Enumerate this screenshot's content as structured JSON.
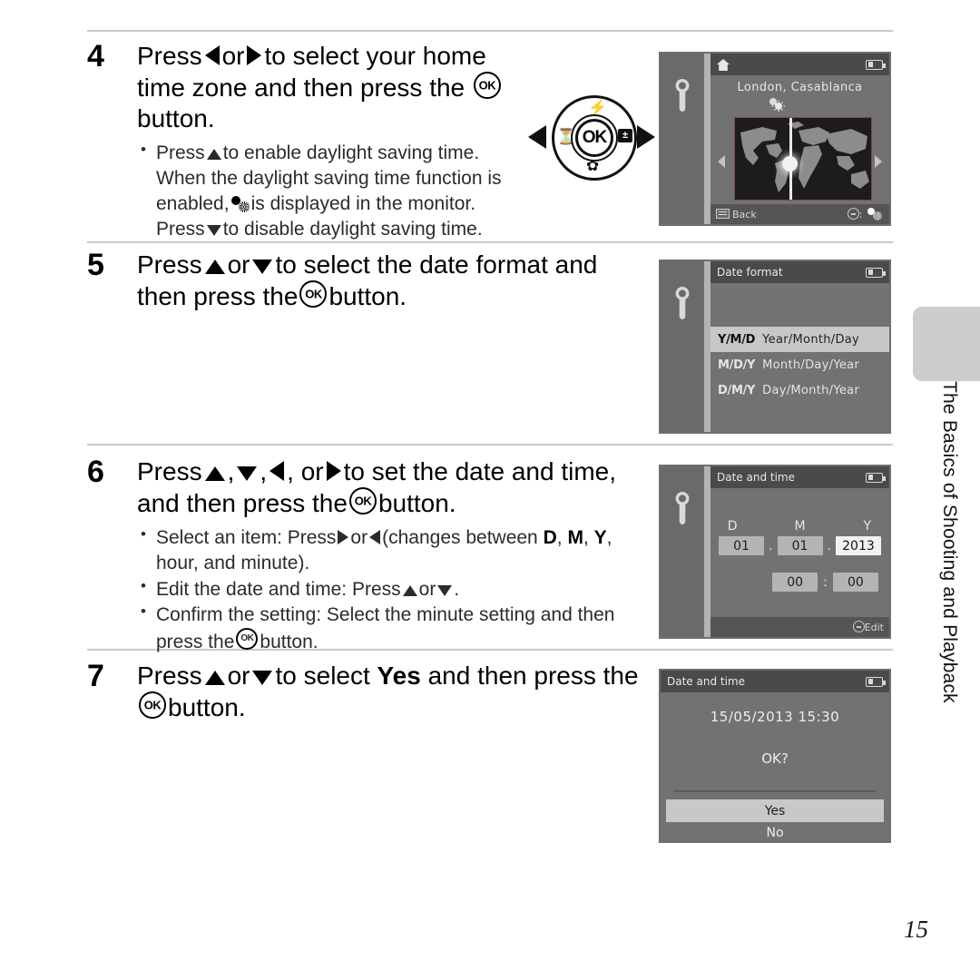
{
  "page": {
    "number": "15",
    "chapter_tab_label": "The Basics of Shooting and Playback"
  },
  "steps": [
    {
      "number": "4",
      "title_parts": [
        "Press ",
        "◀",
        " or ",
        "▶",
        " to select your home time zone and then press the ",
        "OK",
        " button."
      ],
      "title_plain": "Press  or  to select your home time zone and then press the  button.",
      "t1": "Press",
      "t2": "or",
      "t3": "to select your home",
      "t4": "time zone and then press the",
      "t5": "button.",
      "bullets": [
        {
          "a": "Press",
          "b": "to enable daylight saving time.",
          "c": "When the daylight saving time function is",
          "d": "enabled,",
          "e": "is displayed in the monitor.",
          "f": "Press",
          "g": "to disable daylight saving time."
        }
      ]
    },
    {
      "number": "5",
      "t1": "Press",
      "t2": "or",
      "t3": "to select the date format and",
      "t4": "then press the",
      "t5": "button."
    },
    {
      "number": "6",
      "t1": "Press",
      "t2": ",",
      "t3": ",",
      "t4": ", or",
      "t5": "to set the date and time,",
      "t6": "and then press the",
      "t7": "button.",
      "bullets": [
        {
          "a": "Select an item: Press",
          "b": "or",
          "c": "(changes between",
          "d": "D",
          "e": ",",
          "f": "M",
          "g": ",",
          "h": "Y",
          "i": ",",
          "j": "hour, and minute)."
        },
        {
          "a": "Edit the date and time: Press",
          "b": "or",
          "c": "."
        },
        {
          "a": "Confirm the setting: Select the minute setting and then",
          "b": "press the",
          "c": "button."
        }
      ]
    },
    {
      "number": "7",
      "t1": "Press",
      "t2": "or",
      "t3": "to select",
      "t4": "Yes",
      "t5": "and then press the",
      "t6": "button."
    }
  ],
  "multi_selector": {
    "center_label": "OK",
    "top_icon": "flash-icon",
    "left_icon": "self-timer-icon",
    "right_icon": "exposure-compensation-icon",
    "right_icon_label": "±",
    "bottom_icon": "macro-flower-icon",
    "top_glyph": "⚡",
    "left_glyph": "◴",
    "bottom_glyph": "⚘"
  },
  "screens": {
    "time_zone": {
      "title_icon": "home-icon",
      "city": "London, Casablanca",
      "sidebar_icon": "wrench-icon",
      "battery_icon": "battery-icon",
      "bottom_left_label": "Back",
      "bottom_left_icon": "menu-button-icon",
      "bottom_right_label": ":",
      "bottom_right_icon": "multi-selector-icon",
      "bottom_right_icon2": "daylight-saving-icon",
      "map_arrow_left": "arrow-left-icon",
      "map_arrow_right": "arrow-right-icon"
    },
    "date_format": {
      "title": "Date format",
      "sidebar_icon": "wrench-icon",
      "battery_icon": "battery-icon",
      "options": [
        {
          "code": "Y/M/D",
          "label": "Year/Month/Day",
          "selected": true
        },
        {
          "code": "M/D/Y",
          "label": "Month/Day/Year",
          "selected": false
        },
        {
          "code": "D/M/Y",
          "label": "Day/Month/Year",
          "selected": false
        }
      ]
    },
    "date_time_set": {
      "title": "Date and time",
      "sidebar_icon": "wrench-icon",
      "battery_icon": "battery-icon",
      "labels": {
        "day": "D",
        "month": "M",
        "year": "Y"
      },
      "day_value": "01",
      "month_value": "01",
      "year_value": "2013",
      "date_separator": ".",
      "hour_value": "00",
      "minute_value": "00",
      "time_separator": ":",
      "bottom_right_label": "Edit",
      "bottom_right_icon": "multi-selector-icon",
      "highlighted_field": "year"
    },
    "confirm": {
      "title": "Date and time",
      "datetime": "15/05/2013  15:30",
      "question": "OK?",
      "battery_icon": "battery-icon",
      "yes_label": "Yes",
      "no_label": "No",
      "selected": "Yes"
    }
  },
  "colors": {
    "lcd_bg": "#727272",
    "lcd_sidebar": "#6a6a6a",
    "lcd_titlebar": "#4a4a4a",
    "lcd_highlight": "#c8c8c8",
    "chapter_tab": "#cdcdcd",
    "rule": "#c9c9c9"
  }
}
